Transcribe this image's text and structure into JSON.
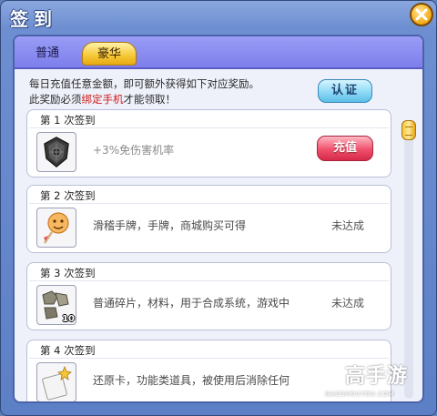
{
  "window": {
    "title": "签到"
  },
  "tabs": [
    {
      "label": "普通",
      "active": false
    },
    {
      "label": "豪华",
      "active": true
    }
  ],
  "notice": {
    "line1": "每日充值任意金额，即可额外获得如下对应奖励。",
    "line2_prefix": "此奖励必须",
    "line2_highlight": "绑定手机",
    "line2_suffix": "才能领取！"
  },
  "verify_button": "认证",
  "rewards": [
    {
      "title": "第 1 次签到",
      "icon": "shield-icon",
      "description": "+3%免伤害机率",
      "action": "充值"
    },
    {
      "title": "第 2 次签到",
      "icon": "lollipop-icon",
      "description": "滑稽手牌，手牌，商城购买可得",
      "status": "未达成"
    },
    {
      "title": "第 3 次签到",
      "icon": "fragments-icon",
      "description": "普通碎片，材料，用于合成系统，游戏中",
      "status": "未达成",
      "count": "10"
    },
    {
      "title": "第 4 次签到",
      "icon": "restore-card-icon",
      "description": "还原卡，功能类道具，被使用后消除任何"
    }
  ],
  "watermark": {
    "text": "高手游",
    "sub": "GAOSHOUYOU.COM"
  },
  "colors": {
    "accent_gold": "#f5c735",
    "recharge_red": "#e23a5a",
    "verify_blue": "#8fdaf6",
    "tab_purple": "#8a8cf0"
  }
}
